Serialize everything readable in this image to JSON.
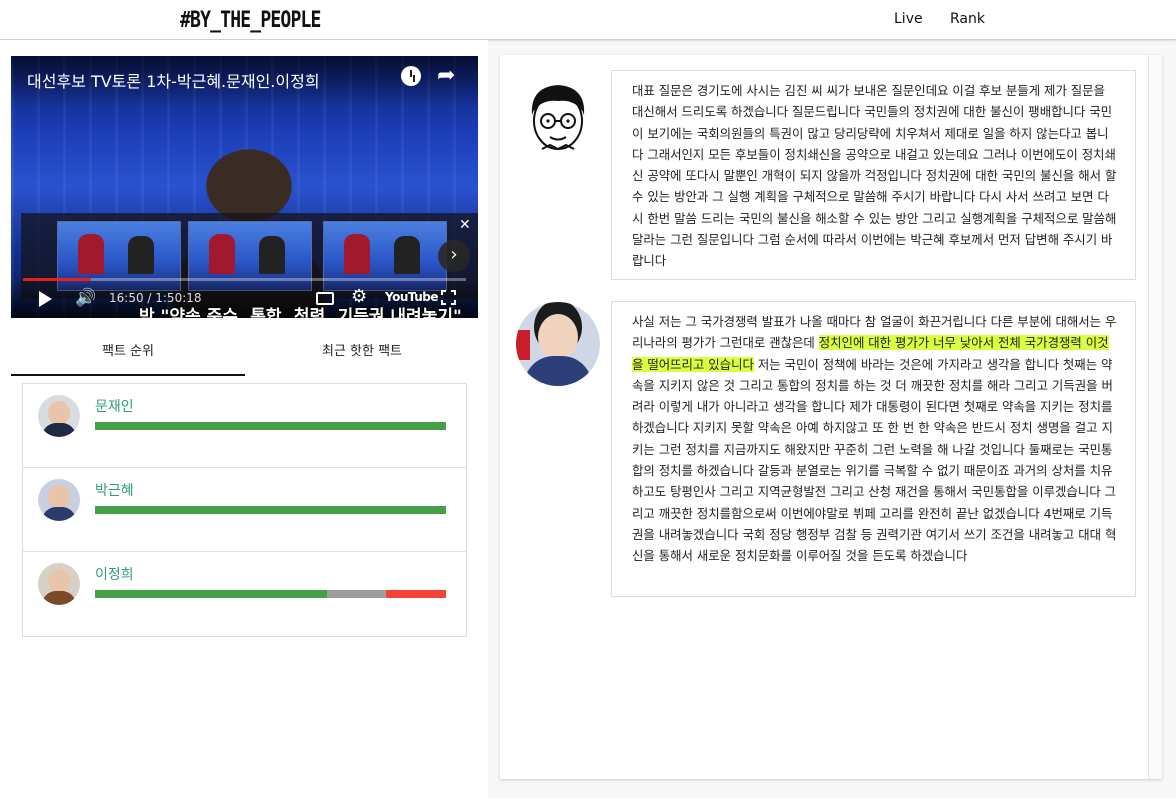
{
  "header": {
    "logo": "#BY_THE_PEOPLE",
    "nav": [
      "Live",
      "Rank"
    ]
  },
  "video": {
    "title": "대선후보 TV토론 1차-박근혜.문재인.이정희",
    "caption": "박 \"약속 준수, 통합, 청렴, 기득권 내려놓기\"",
    "time": "16:50 / 1:50:18",
    "youtube_label": "YouTube",
    "progress": 0.153,
    "icons": [
      "clock-icon",
      "share-icon",
      "play-icon",
      "volume-icon",
      "captions-icon",
      "settings-icon",
      "fullscreen-icon",
      "close-icon",
      "chevron-right-icon"
    ]
  },
  "tabs": [
    "팩트 순위",
    "최근 핫한 팩트"
  ],
  "ranking": [
    {
      "name": "문재인",
      "positive": 1.0,
      "neutral": 0.0,
      "negative": 0.0
    },
    {
      "name": "박근혜",
      "positive": 1.0,
      "neutral": 0.0,
      "negative": 0.0
    },
    {
      "name": "이정희",
      "positive": 0.66,
      "neutral": 0.17,
      "negative": 0.17
    }
  ],
  "colors": {
    "accent_name": "#2f9e7a",
    "positive": "#43a047",
    "neutral": "#9e9e9e",
    "negative": "#f44336",
    "highlight": "#d9ff3f"
  },
  "messages": [
    {
      "speaker_icon": "moderator-cartoon-icon",
      "text": "대표 질문은 경기도에 사시는 김진 씨 씨가 보내온 질문인데요 이걸 후보 분들게 제가 질문을 대신해서 드리도록 하겠습니다 질문드립니다 국민들의 정치권에 대한 불신이 팽배합니다 국민이 보기에는 국회의원들의 특권이 많고 당리당략에 치우쳐서 제대로 일을 하지 않는다고 봅니다 그래서인지 모든 후보들이 정치쇄신을 공약으로 내걸고 있는데요 그러나 이번에도이 정치쇄신 공약에 또다시 말뿐인 개혁이 되지 않을까 걱정입니다 정치권에 대한 국민의 불신을 해서 할 수 있는 방안과 그 실행 계획을 구체적으로 말씀해 주시기 바랍니다 다시 사서 쓰려고 보면 다시 한번 말씀 드리는 국민의 불신을 해소할 수 있는 방안 그리고 실행계획을 구체적으로 말씀해 달라는 그런 질문입니다 그럼 순서에 따라서 이번에는 박근혜 후보께서 먼저 답변해 주시기 바랍니다"
    },
    {
      "speaker_icon": "candidate-photo-icon",
      "text_before": "사실 저는 그 국가경쟁력 발표가 나올 때마다 참 얼굴이 화끈거립니다 다른 부분에 대해서는 우리나라의 평가가 그런대로 괜찮은데 ",
      "highlight": "정치인에 대한 평가가 너무 낮아서 전체 국가경쟁력 이것을 떨어뜨리고 있습니다",
      "text_after": " 저는 국민이 정책에 바라는 것은에 가지라고 생각을 합니다 첫째는 약속을 지키지 않은 것 그리고 통합의 정치를 하는 것 더 깨끗한 정치를 해라 그리고 기득권을 버려라 이렇게 내가 아니라고 생각을 합니다 제가 대통령이 된다면 첫째로 약속을 지키는 정치를 하겠습니다 지키지 못할 약속은 아예 하지않고 또 한 번 한 약속은 반드시 정치 생명을 걸고 지키는 그런 정치를 지금까지도 해왔지만 꾸준히 그런 노력을 해 나갈 것입니다 둘째로는 국민통합의 정치를 하겠습니다 갈등과 분열로는 위기를 극복할 수 없기 때문이죠 과거의 상처를 치유하고도 탕평인사 그리고 지역균형발전 그리고 산청 재건을 통해서 국민통합을 이루겠습니다 그리고 깨끗한 정치를함으로써 이번에야말로 뷔페 고리를 완전히 끝난 없겠습니다 4번째로 기득권을 내려놓겠습니다 국회 정당 행정부 검찰 등 권력기관 여기서 쓰기 조건을 내려놓고 대대 혁신을 통해서 새로운 정치문화를 이루어질 것을 든도록 하겠습니다"
    }
  ]
}
